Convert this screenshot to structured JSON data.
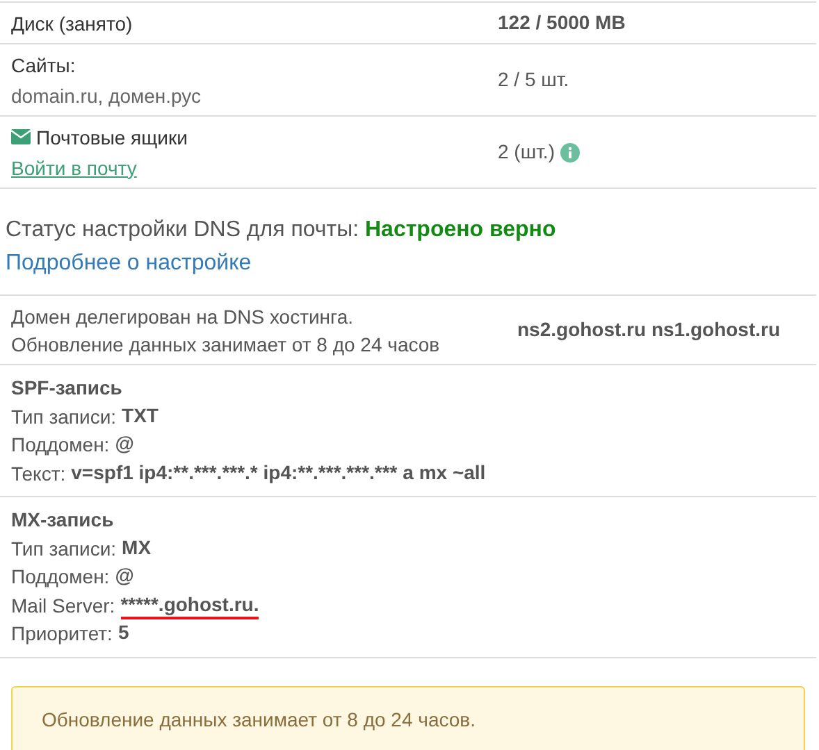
{
  "stats": [
    {
      "kind": "plain",
      "label": "Диск (занято)",
      "value": "122 / 5000 MB",
      "value_bold": true
    },
    {
      "kind": "sub",
      "label": "Сайты:",
      "sub": "domain.ru, домен.рус",
      "value": "2 / 5 шт.",
      "value_bold": false
    },
    {
      "kind": "mail",
      "label": "Почтовые ящики",
      "link": "Войти в почту",
      "value": "2 (шт.)",
      "value_bold": false,
      "info": true
    }
  ],
  "dns_status": {
    "label": "Статус настройки DNS для почты:",
    "status": "Настроено верно",
    "ok": true,
    "link": "Подробнее о настройке"
  },
  "delegation": {
    "lines": [
      "Домен делегирован на DNS хостинга.",
      "Обновление данных занимает от 8 до 24 часов"
    ],
    "servers": "ns2.gohost.ru ns1.gohost.ru"
  },
  "records": [
    {
      "title": "SPF-запись",
      "lines": [
        {
          "label": "Тип записи:",
          "value": "TXT",
          "marked": false
        },
        {
          "label": "Поддомен:",
          "value": "@",
          "marked": false
        },
        {
          "label": "Текст:",
          "value": "v=spf1 ip4:**.***.***.* ip4:**.***.***.*** a mx ~all",
          "marked": false
        }
      ]
    },
    {
      "title": "MX-запись",
      "lines": [
        {
          "label": "Тип записи:",
          "value": "MX",
          "marked": false
        },
        {
          "label": "Поддомен:",
          "value": "@",
          "marked": false
        },
        {
          "label": "Mail Server:",
          "value": "*****.gohost.ru.",
          "marked": true
        },
        {
          "label": "Приоритет:",
          "value": "5",
          "marked": false
        }
      ]
    }
  ],
  "alert": "Обновление данных занимает от 8 до 24 часов."
}
